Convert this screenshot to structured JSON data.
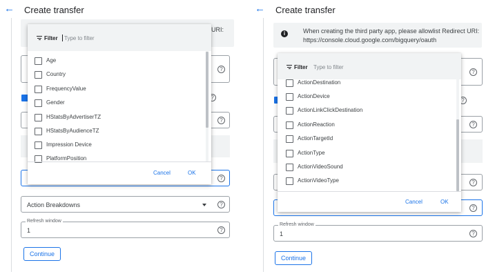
{
  "left": {
    "title": "Create transfer",
    "uri_fragment": "URI:",
    "filter_label": "Filter",
    "filter_placeholder": "Type to filter",
    "options": [
      "Age",
      "Country",
      "FrequencyValue",
      "Gender",
      "HStatsByAdvertiserTZ",
      "HStatsByAudienceTZ",
      "Impression Device",
      "PlatformPosition"
    ],
    "cancel": "Cancel",
    "ok": "OK",
    "action_breakdowns": "Action Breakdowns",
    "refresh_label": "Refresh window",
    "refresh_value": "1",
    "continue": "Continue"
  },
  "right": {
    "title": "Create transfer",
    "info_line1": "When creating the third party app, please allowlist Redirect URI:",
    "info_line2": "https://console.cloud.google.com/bigquery/oauth",
    "filter_label": "Filter",
    "filter_placeholder": "Type to filter",
    "options": [
      "ActionDestination",
      "ActionDevice",
      "ActionLinkClickDestination",
      "ActionReaction",
      "ActionTargetId",
      "ActionType",
      "ActionVideoSound",
      "ActionVideoType"
    ],
    "cancel": "Cancel",
    "ok": "OK",
    "refresh_label": "Refresh window",
    "refresh_value": "1",
    "continue": "Continue"
  },
  "icons": {
    "back": "arrow-left-icon",
    "help": "question-circle-icon",
    "info": "info-icon",
    "filter": "filter-lines-icon",
    "dropdown": "caret-down-icon"
  },
  "colors": {
    "accent": "#1a73e8",
    "info_bg": "#f1f3f4",
    "popup_head_bg": "#f1f3f4"
  }
}
